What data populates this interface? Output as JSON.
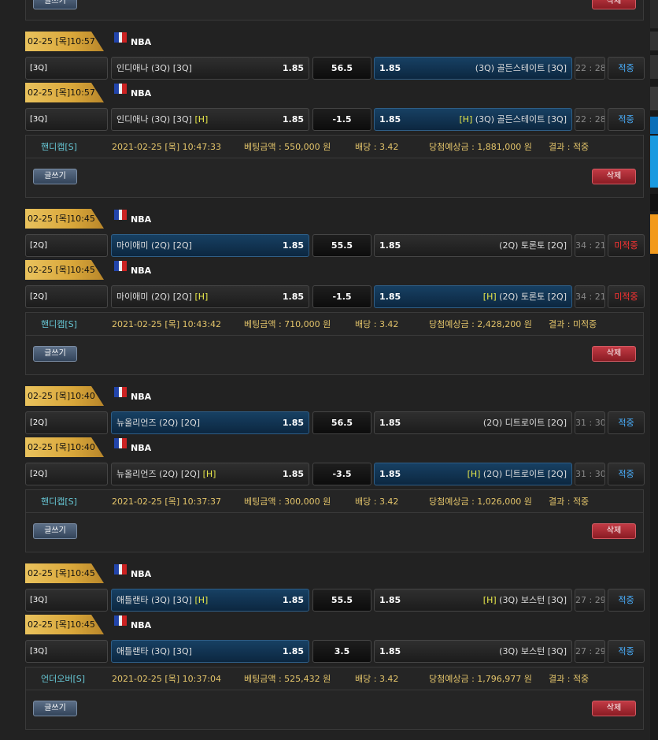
{
  "top": {
    "write_label": "글쓰기",
    "delete_label": "삭제"
  },
  "bets": [
    {
      "games": [
        {
          "date": "02-25 [목]10:57",
          "league": "NBA",
          "period": "[3Q]",
          "home": "인디애나 (3Q) [3Q]",
          "home_h": "",
          "home_odd": "1.85",
          "line": "56.5",
          "away_odd": "1.85",
          "away": "(3Q) 골든스테이트 [3Q]",
          "away_h": "",
          "score": "22 : 28",
          "result": "적중",
          "selected": "away"
        },
        {
          "date": "02-25 [목]10:57",
          "league": "NBA",
          "period": "[3Q]",
          "home": "인디애나 (3Q) [3Q]",
          "home_h": "[H]",
          "home_odd": "1.85",
          "line": "-1.5",
          "away_odd": "1.85",
          "away": "(3Q) 골든스테이트 [3Q]",
          "away_h": "[H]",
          "score": "22 : 28",
          "result": "적중",
          "selected": "away"
        }
      ],
      "summary": {
        "type": "핸디캡[S]",
        "time": "2021-02-25 [목] 10:47:33",
        "amount": "베팅금액 : 550,000 원",
        "rate": "배당 : 3.42",
        "payout": "당첨예상금 : 1,881,000 원",
        "outcome": "결과 : 적중",
        "write_label": "글쓰기",
        "delete_label": "삭제"
      }
    },
    {
      "games": [
        {
          "date": "02-25 [목]10:45",
          "league": "NBA",
          "period": "[2Q]",
          "home": "마이애미 (2Q) [2Q]",
          "home_h": "",
          "home_odd": "1.85",
          "line": "55.5",
          "away_odd": "1.85",
          "away": "(2Q) 토론토 [2Q]",
          "away_h": "",
          "score": "34 : 21",
          "result": "미적중",
          "selected": "home"
        },
        {
          "date": "02-25 [목]10:45",
          "league": "NBA",
          "period": "[2Q]",
          "home": "마이애미 (2Q) [2Q]",
          "home_h": "[H]",
          "home_odd": "1.85",
          "line": "-1.5",
          "away_odd": "1.85",
          "away": "(2Q) 토론토 [2Q]",
          "away_h": "[H]",
          "score": "34 : 21",
          "result": "미적중",
          "selected": "away"
        }
      ],
      "summary": {
        "type": "핸디캡[S]",
        "time": "2021-02-25 [목] 10:43:42",
        "amount": "베팅금액 : 710,000 원",
        "rate": "배당 : 3.42",
        "payout": "당첨예상금 : 2,428,200 원",
        "outcome": "결과 : 미적중",
        "write_label": "글쓰기",
        "delete_label": "삭제"
      }
    },
    {
      "games": [
        {
          "date": "02-25 [목]10:40",
          "league": "NBA",
          "period": "[2Q]",
          "home": "뉴올리언즈 (2Q) [2Q]",
          "home_h": "",
          "home_odd": "1.85",
          "line": "56.5",
          "away_odd": "1.85",
          "away": "(2Q) 디트로이트 [2Q]",
          "away_h": "",
          "score": "31 : 30",
          "result": "적중",
          "selected": "home"
        },
        {
          "date": "02-25 [목]10:40",
          "league": "NBA",
          "period": "[2Q]",
          "home": "뉴올리언즈 (2Q) [2Q]",
          "home_h": "[H]",
          "home_odd": "1.85",
          "line": "-3.5",
          "away_odd": "1.85",
          "away": "(2Q) 디트로이트 [2Q]",
          "away_h": "[H]",
          "score": "31 : 30",
          "result": "적중",
          "selected": "away"
        }
      ],
      "summary": {
        "type": "핸디캡[S]",
        "time": "2021-02-25 [목] 10:37:37",
        "amount": "베팅금액 : 300,000 원",
        "rate": "배당 : 3.42",
        "payout": "당첨예상금 : 1,026,000 원",
        "outcome": "결과 : 적중",
        "write_label": "글쓰기",
        "delete_label": "삭제"
      }
    },
    {
      "games": [
        {
          "date": "02-25 [목]10:45",
          "league": "NBA",
          "period": "[3Q]",
          "home": "애틀랜타 (3Q) [3Q]",
          "home_h": "[H]",
          "home_odd": "1.85",
          "line": "55.5",
          "away_odd": "1.85",
          "away": "(3Q) 보스턴 [3Q]",
          "away_h": "[H]",
          "score": "27 : 29",
          "result": "적중",
          "selected": "home"
        },
        {
          "date": "02-25 [목]10:45",
          "league": "NBA",
          "period": "[3Q]",
          "home": "애틀랜타 (3Q) [3Q]",
          "home_h": "",
          "home_odd": "1.85",
          "line": "3.5",
          "away_odd": "1.85",
          "away": "(3Q) 보스턴 [3Q]",
          "away_h": "",
          "score": "27 : 29",
          "result": "적중",
          "selected": "home"
        }
      ],
      "summary": {
        "type": "언더오버[S]",
        "time": "2021-02-25 [목] 10:37:04",
        "amount": "베팅금액 : 525,432 원",
        "rate": "배당 : 3.42",
        "payout": "당첨예상금 : 1,796,977 원",
        "outcome": "결과 : 적중",
        "write_label": "글쓰기",
        "delete_label": "삭제"
      }
    }
  ],
  "colors": {
    "selected_bg": "#174063",
    "win": "#4ab0ff",
    "lose": "#ff3333",
    "info_text": "#e3c46a",
    "type_text": "#67c8d6",
    "date_gold": "#e9c25d"
  }
}
